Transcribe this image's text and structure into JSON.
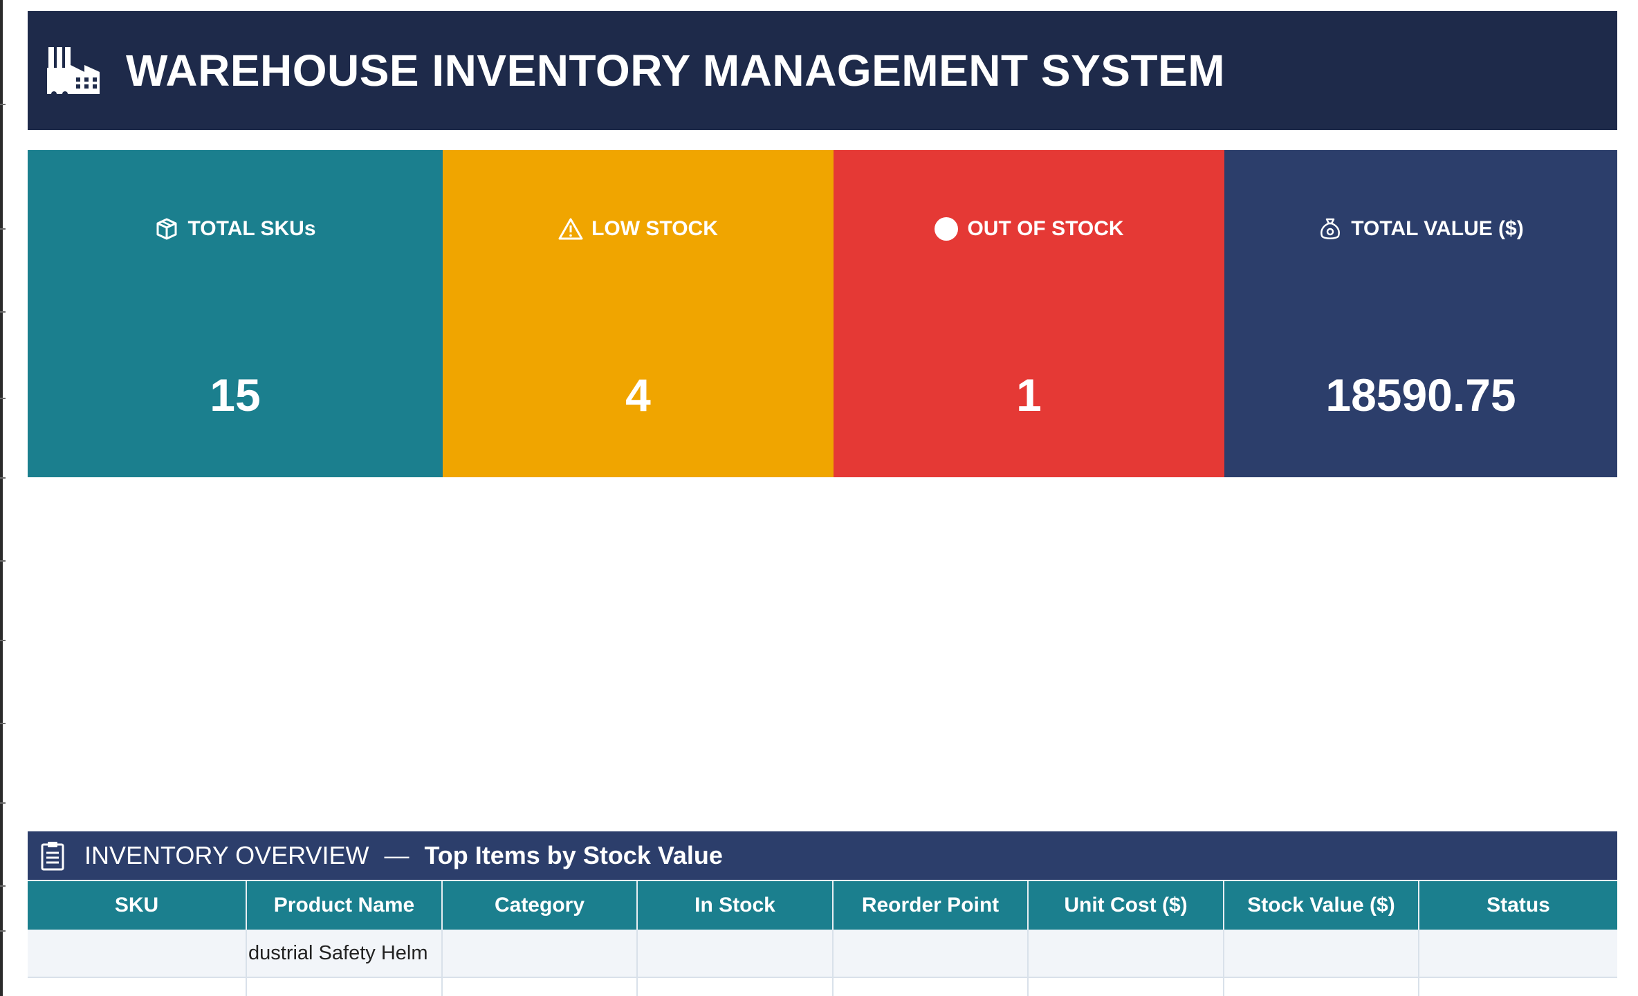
{
  "header": {
    "title": "WAREHOUSE INVENTORY MANAGEMENT SYSTEM",
    "icon": "factory-icon"
  },
  "kpis": [
    {
      "label": "TOTAL SKUs",
      "value": "15",
      "icon": "package-icon",
      "color": "#1b7f8e"
    },
    {
      "label": "LOW STOCK",
      "value": "4",
      "icon": "warning-icon",
      "color": "#f0a500"
    },
    {
      "label": "OUT OF STOCK",
      "value": "1",
      "icon": "circle-icon",
      "color": "#e53935"
    },
    {
      "label": "TOTAL VALUE ($)",
      "value": "18590.75",
      "icon": "money-bag-icon",
      "color": "#2c3e6b"
    }
  ],
  "inventory": {
    "section_title": "INVENTORY OVERVIEW",
    "dash": "—",
    "section_subtitle": "Top Items by Stock Value",
    "icon": "clipboard-icon",
    "columns": [
      "SKU",
      "Product Name",
      "Category",
      "In Stock",
      "Reorder Point",
      "Unit Cost ($)",
      "Stock Value ($)",
      "Status"
    ],
    "rows": [
      {
        "sku": "",
        "product_name": "dustrial Safety Helm",
        "category": "",
        "in_stock": "",
        "reorder_point": "",
        "unit_cost": "",
        "stock_value": "",
        "status": ""
      },
      {
        "sku": "",
        "product_name": "",
        "category": "",
        "in_stock": "",
        "reorder_point": "",
        "unit_cost": "",
        "stock_value": "",
        "status": ""
      }
    ]
  },
  "colors": {
    "header_bg": "#1e2a4a",
    "section_bg": "#2c3e6b",
    "table_header_bg": "#1b7f8e",
    "row_bg": "#f2f5f9"
  }
}
